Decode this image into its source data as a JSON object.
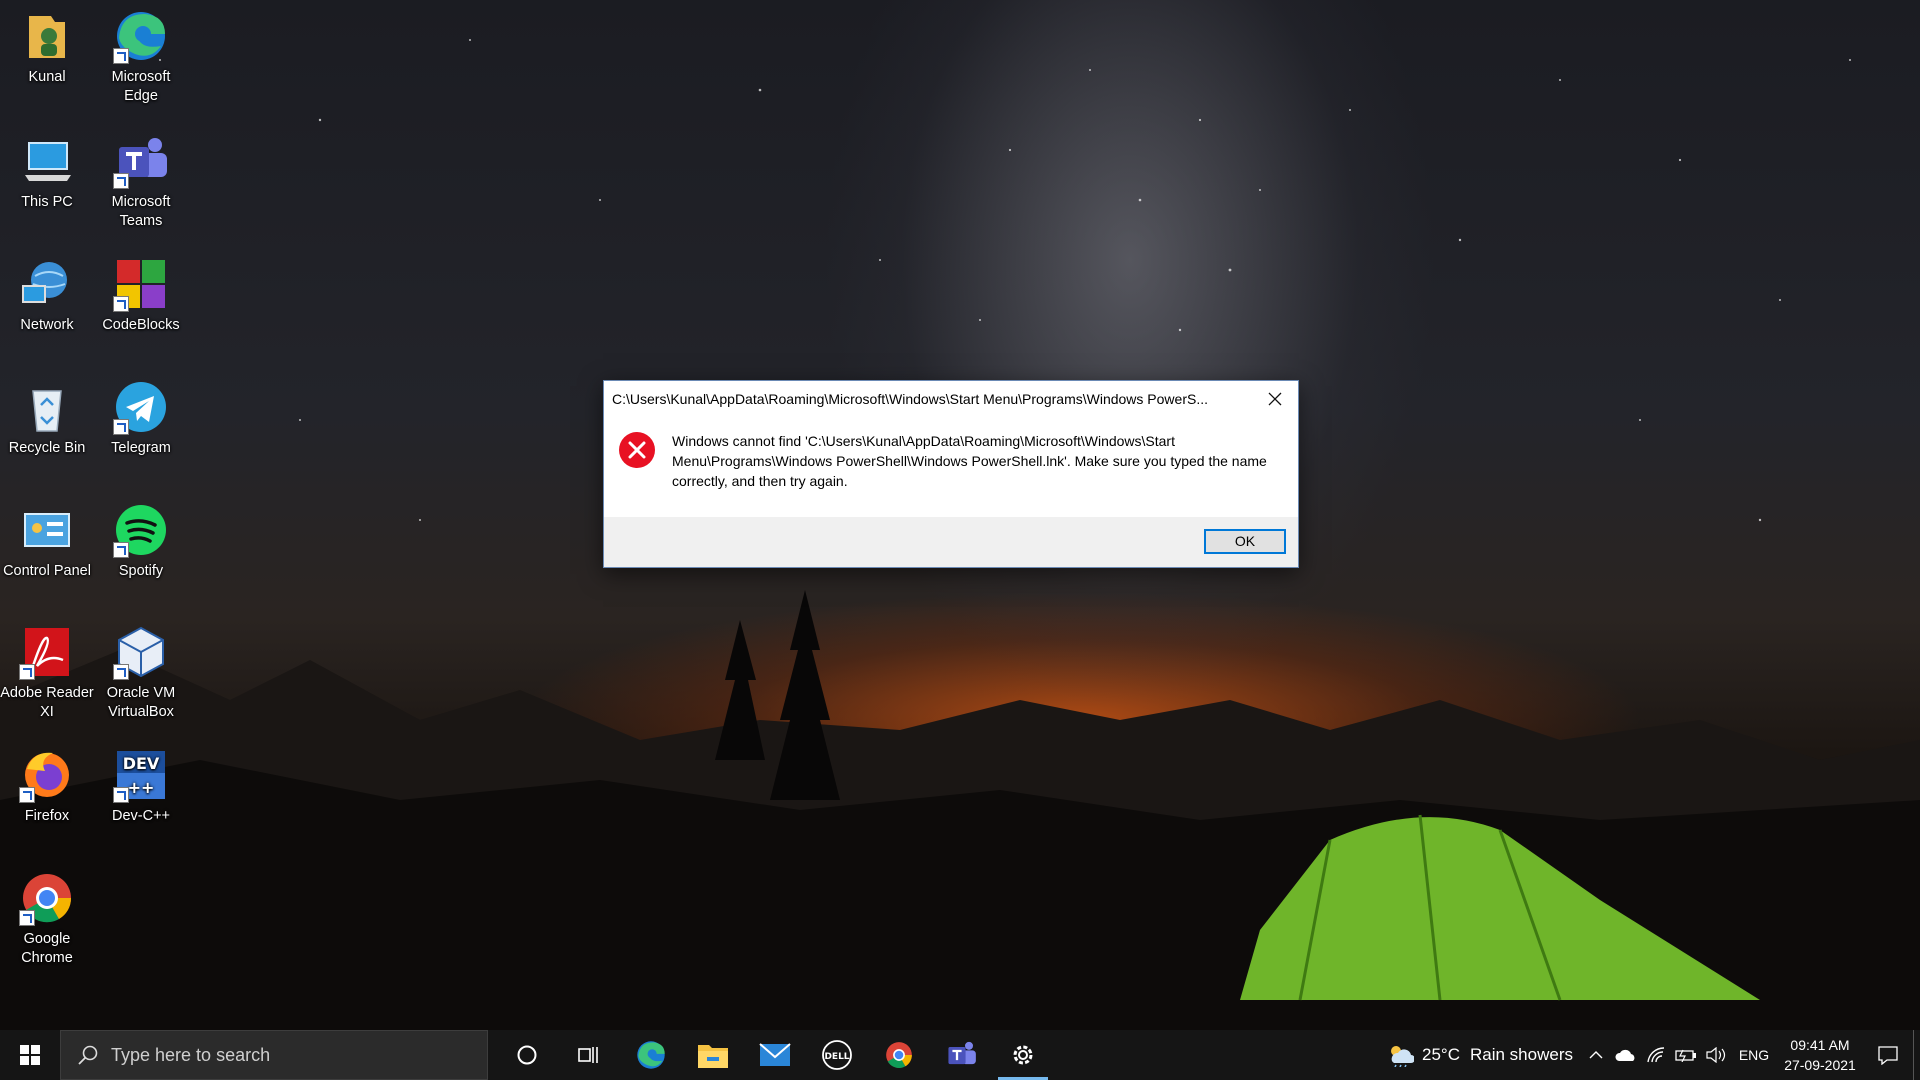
{
  "desktop": {
    "icons": [
      {
        "label": "Kunal"
      },
      {
        "label": "Microsoft Edge"
      },
      {
        "label": "This PC"
      },
      {
        "label": "Microsoft Teams"
      },
      {
        "label": "Network"
      },
      {
        "label": "CodeBlocks"
      },
      {
        "label": "Recycle Bin"
      },
      {
        "label": "Telegram"
      },
      {
        "label": "Control Panel"
      },
      {
        "label": "Spotify"
      },
      {
        "label": "Adobe Reader XI"
      },
      {
        "label": "Oracle VM VirtualBox"
      },
      {
        "label": "Firefox"
      },
      {
        "label": "Dev-C++"
      },
      {
        "label": "Google Chrome"
      }
    ]
  },
  "dialog": {
    "title": "C:\\Users\\Kunal\\AppData\\Roaming\\Microsoft\\Windows\\Start Menu\\Programs\\Windows PowerS...",
    "message": "Windows cannot find 'C:\\Users\\Kunal\\AppData\\Roaming\\Microsoft\\Windows\\Start Menu\\Programs\\Windows PowerShell\\Windows PowerShell.lnk'. Make sure you typed the name correctly, and then try again.",
    "ok_label": "OK",
    "icon": "error-icon"
  },
  "taskbar": {
    "search_placeholder": "Type here to search",
    "pinned": [
      "cortana-icon",
      "task-view-icon",
      "edge-icon",
      "file-explorer-icon",
      "mail-icon",
      "dell-icon",
      "chrome-icon",
      "teams-icon",
      "settings-icon"
    ],
    "active": "settings-icon",
    "weather": {
      "temp": "25°C",
      "desc": "Rain showers"
    },
    "language": "ENG",
    "time": "09:41 AM",
    "date": "27-09-2021"
  },
  "colors": {
    "accent": "#0078d7",
    "taskbar": "#151515",
    "error": "#e81123"
  }
}
